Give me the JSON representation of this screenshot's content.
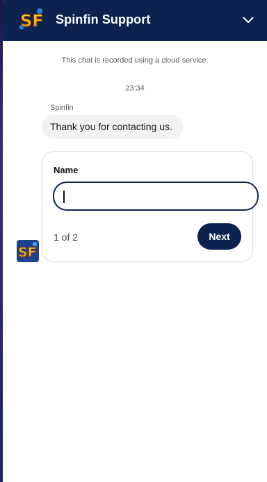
{
  "header": {
    "title": "Spinfin Support",
    "logo_text": "SF",
    "collapse_icon": "chevron-down-icon"
  },
  "chat": {
    "notice": "This chat is recorded using a cloud service.",
    "timestamp": "23:34",
    "sender": "Spinfin",
    "message": "Thank you for contacting us."
  },
  "form": {
    "field_label": "Name",
    "field_value": "",
    "field_placeholder": "",
    "step": "1 of 2",
    "next_label": "Next"
  },
  "colors": {
    "brand": "#0c2350",
    "bubble": "#f1f2f4"
  }
}
